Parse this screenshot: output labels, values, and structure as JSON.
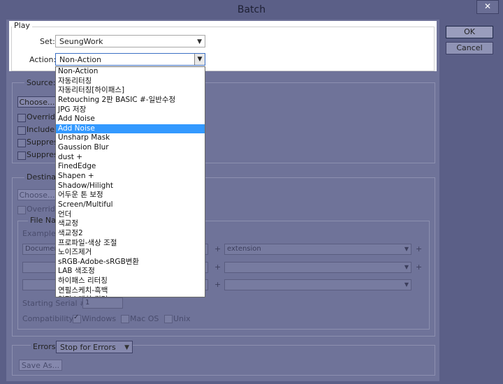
{
  "window": {
    "title": "Batch",
    "close_glyph": "✕"
  },
  "play": {
    "legend": "Play",
    "set_label": "Set:",
    "set_value": "SeungWork",
    "action_label": "Action:",
    "action_value": "Non-Action"
  },
  "source": {
    "legend": "Source:",
    "choose_button": "Choose...",
    "override_label": "Override",
    "include_label": "Include A",
    "suppress1_label": "Suppress",
    "suppress2_label": "Suppress"
  },
  "destination": {
    "legend": "Destinati",
    "choose_button": "Choose...",
    "override_label": "Override",
    "file_naming": {
      "legend": "File Nar",
      "example_label": "Example:",
      "row1_left": "Documen",
      "row1_right": "extension",
      "starting_serial_label": "Starting Serial #:",
      "starting_serial_value": "1",
      "compatibility_label": "Compatibility:",
      "windows_label": "Windows",
      "mac_label": "Mac OS",
      "unix_label": "Unix"
    }
  },
  "errors": {
    "label": "Errors:",
    "value": "Stop for Errors",
    "save_as_button": "Save As..."
  },
  "buttons": {
    "ok": "OK",
    "cancel": "Cancel"
  },
  "action_dropdown": {
    "selected_index": 6,
    "options": [
      "Non-Action",
      "자동리터칭",
      "자동리터칭[하이패스]",
      "Retouching  2판 BASIC #-일반수정",
      "JPG 저장",
      "Add Noise",
      "Add Noise",
      "Unsharp Mask",
      "Gaussion Blur",
      "dust +",
      "FinedEdge",
      "Shapen +",
      "Shadow/Hilight",
      "어두운 톤 보정",
      "Screen/Multiful",
      "언더",
      "색교정",
      "색교정2",
      "프로파일-색상 조절",
      "노이즈제거",
      "sRGB-Adobe-sRGB변환",
      "LAB 색조정",
      "하이패스 리터칭",
      "연필스케치-흑백",
      "연필스케치-컬러"
    ]
  }
}
